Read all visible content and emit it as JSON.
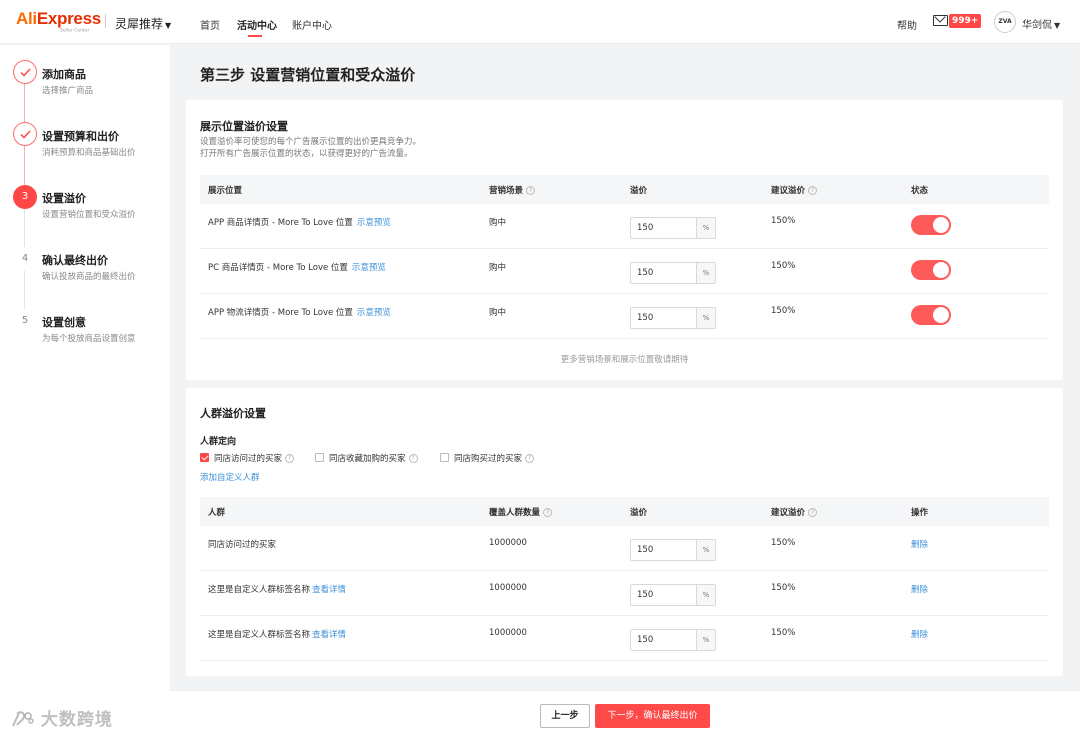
{
  "header": {
    "logo_ali": "Ali",
    "logo_express": "Express",
    "logo_sub": "Seller Center",
    "product_switch": "灵犀推荐",
    "nav": [
      "首页",
      "活动中心",
      "账户中心"
    ],
    "help": "帮助",
    "mail_badge": "999+",
    "avatar_text": "ZVA",
    "user_name": "华剑侃"
  },
  "sidebar": {
    "steps": [
      {
        "number": "1",
        "title": "添加商品",
        "desc": "选择推广商品",
        "state": "done"
      },
      {
        "number": "2",
        "title": "设置预算和出价",
        "desc": "消耗预算和商品基础出价",
        "state": "done"
      },
      {
        "number": "3",
        "title": "设置溢价",
        "desc": "设置营销位置和受众溢价",
        "state": "current"
      },
      {
        "number": "4",
        "title": "确认最终出价",
        "desc": "确认投放商品的最终出价",
        "state": "todo"
      },
      {
        "number": "5",
        "title": "设置创意",
        "desc": "为每个投放商品设置创意",
        "state": "todo"
      }
    ]
  },
  "main": {
    "page_title": "第三步 设置营销位置和受众溢价",
    "placement": {
      "title": "展示位置溢价设置",
      "desc_line1": "设置溢价率可使您的每个广告展示位置的出价更具竞争力。",
      "desc_line2": "打开所有广告展示位置的状态，以获得更好的广告流量。",
      "columns": [
        "展示位置",
        "营销场景",
        "溢价",
        "建议溢价",
        "状态"
      ],
      "rows": [
        {
          "position": "APP 商品详情页 - More To Love 位置",
          "link": "示意预览",
          "scene": "购中",
          "premium": "150",
          "unit": "%",
          "suggested": "150%",
          "status": "on"
        },
        {
          "position": "PC 商品详情页 - More To Love 位置",
          "link": "示意预览",
          "scene": "购中",
          "premium": "150",
          "unit": "%",
          "suggested": "150%",
          "status": "on"
        },
        {
          "position": "APP 物流详情页 - More To Love 位置",
          "link": "示意预览",
          "scene": "购中",
          "premium": "150",
          "unit": "%",
          "suggested": "150%",
          "status": "on"
        }
      ],
      "more_note": "更多营销场景和展示位置敬请期待"
    },
    "audience": {
      "title": "人群溢价设置",
      "targeting_label": "人群定向",
      "options": [
        {
          "label": "同店访问过的买家",
          "checked": true
        },
        {
          "label": "同店收藏加购的买家",
          "checked": false
        },
        {
          "label": "同店购买过的买家",
          "checked": false
        }
      ],
      "add_custom": "添加自定义人群",
      "columns": [
        "人群",
        "覆盖人群数量",
        "溢价",
        "建议溢价",
        "操作"
      ],
      "rows": [
        {
          "name": "同店访问过的买家",
          "link": "",
          "count": "1000000",
          "premium": "150",
          "unit": "%",
          "suggested": "150%",
          "action": "删除"
        },
        {
          "name": "这里是自定义人群标签名称",
          "link": "查看详情",
          "count": "1000000",
          "premium": "150",
          "unit": "%",
          "suggested": "150%",
          "action": "删除"
        },
        {
          "name": "这里是自定义人群标签名称",
          "link": "查看详情",
          "count": "1000000",
          "premium": "150",
          "unit": "%",
          "suggested": "150%",
          "action": "删除"
        }
      ]
    }
  },
  "footer": {
    "prev": "上一步",
    "next": "下一步，确认最终出价"
  },
  "watermark": "大数跨境",
  "colors": {
    "accent": "#ff4747",
    "link": "#3b8fd9",
    "toggle_on": "#ff5a5a"
  }
}
